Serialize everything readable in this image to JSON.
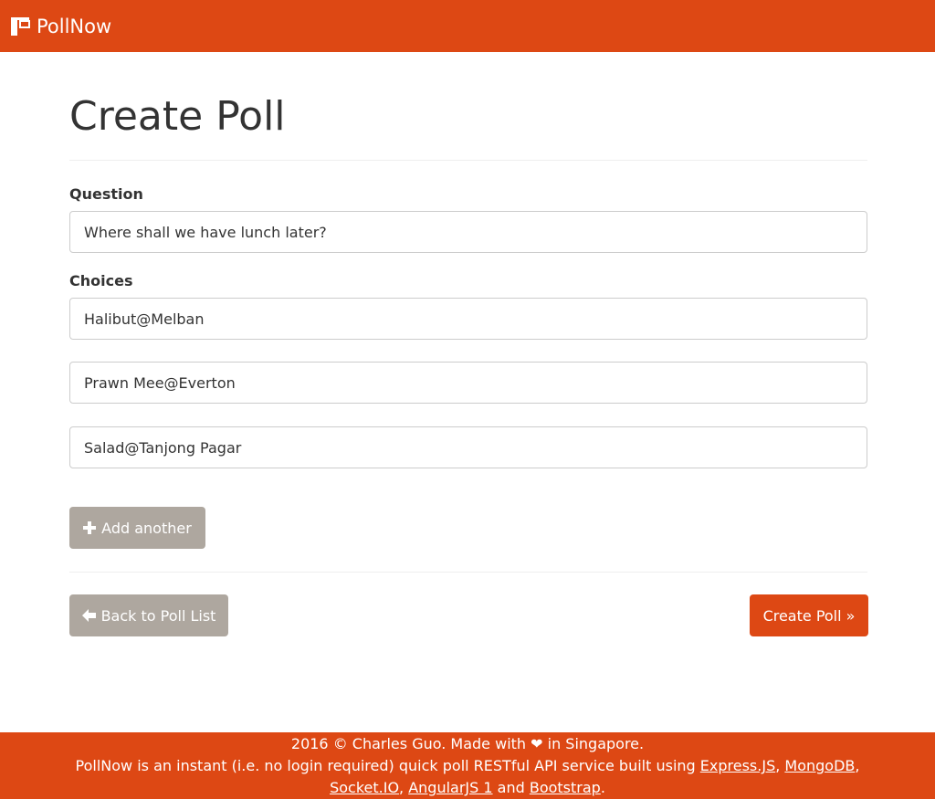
{
  "navbar": {
    "brand_icon": "poll-logo-icon",
    "brand_name": "PollNow"
  },
  "page": {
    "title": "Create Poll"
  },
  "form": {
    "question_label": "Question",
    "question_value": "Where shall we have lunch later?",
    "choices_label": "Choices",
    "choices": [
      "Halibut@Melban",
      "Prawn Mee@Everton",
      "Salad@Tanjong Pagar"
    ],
    "add_another_label": "Add another",
    "add_another_icon": "plus-icon",
    "back_label": "Back to Poll List",
    "back_icon": "arrow-left-icon",
    "create_label": "Create Poll »"
  },
  "footer": {
    "line1": "2016 © Charles Guo. Made with ❤ in Singapore.",
    "line2_prefix": "PollNow is an instant (i.e. no login required) quick poll RESTful API service built using ",
    "links": [
      "Express.JS",
      "MongoDB",
      "Socket.IO",
      "AngularJS 1",
      "Bootstrap"
    ],
    "sep1": ", ",
    "sep2": ",",
    "sep3": ", ",
    "sep4": " and ",
    "end": "."
  },
  "colors": {
    "brand": "#dd4814",
    "secondary": "#aea79f"
  }
}
